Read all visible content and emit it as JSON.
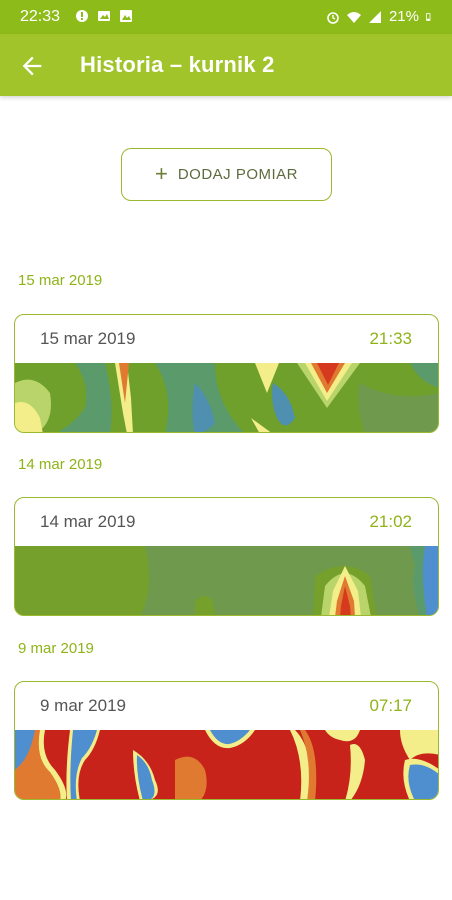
{
  "status": {
    "time": "22:33",
    "battery": "21%"
  },
  "header": {
    "title": "Historia – kurnik 2"
  },
  "add_button": {
    "label": "DODAJ POMIAR"
  },
  "entries": [
    {
      "section_date": "15 mar 2019",
      "date": "15 mar 2019",
      "time": "21:33"
    },
    {
      "section_date": "14 mar 2019",
      "date": "14 mar 2019",
      "time": "21:02"
    },
    {
      "section_date": "9 mar 2019",
      "date": "9 mar 2019",
      "time": "07:17"
    }
  ],
  "colors": {
    "status_bar": "#8dbb1a",
    "app_bar": "#a1c42a",
    "accent": "#8fb319"
  }
}
